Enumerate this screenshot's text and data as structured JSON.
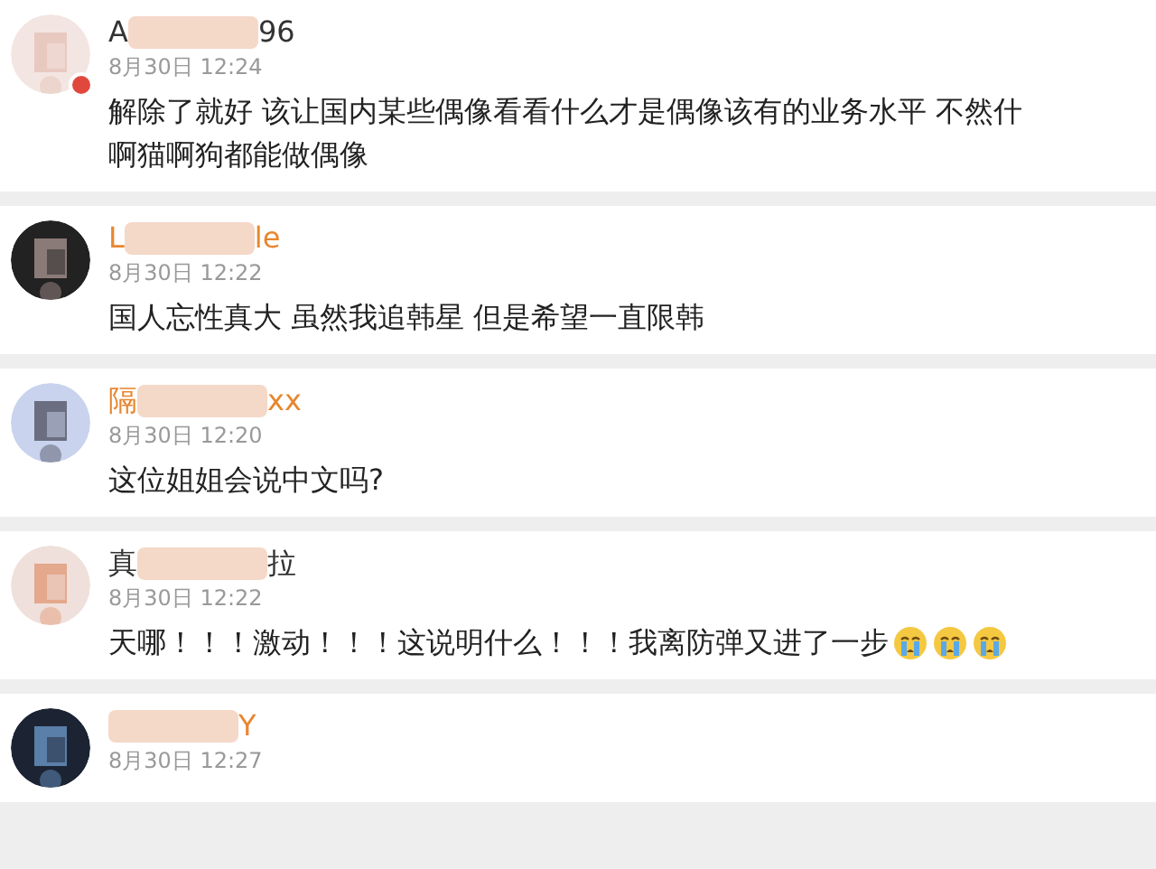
{
  "comments": [
    {
      "name_start": "A",
      "name_end": "96",
      "color": "#333333",
      "badge": true,
      "time": "8月30日 12:24",
      "lines": [
        "解除了就好 该让国内某些偶像看看什么才是偶像该有的业务水平 不然什",
        "啊猫啊狗都能做偶像"
      ]
    },
    {
      "name_start": "L",
      "name_end": "le",
      "color": "#e8862e",
      "badge": false,
      "time": "8月30日 12:22",
      "lines": [
        "国人忘性真大 虽然我追韩星 但是希望一直限韩"
      ]
    },
    {
      "name_start": "隔",
      "name_end": "xx",
      "color": "#e8862e",
      "badge": false,
      "time": "8月30日 12:20",
      "lines": [
        "这位姐姐会说中文吗?"
      ]
    },
    {
      "name_start": "真",
      "name_end": "拉",
      "color": "#333333",
      "badge": false,
      "time": "8月30日 12:22",
      "lines": [
        "天哪！！！激动！！！这说明什么！！！我离防弹又进了一步"
      ],
      "emojis": [
        {
          "kind": "crying"
        },
        {
          "kind": "crying"
        },
        {
          "kind": "crying"
        }
      ]
    },
    {
      "name_end": "Y",
      "color": "#e8862e",
      "badge": false,
      "time": "8月30日 12:27"
    }
  ]
}
